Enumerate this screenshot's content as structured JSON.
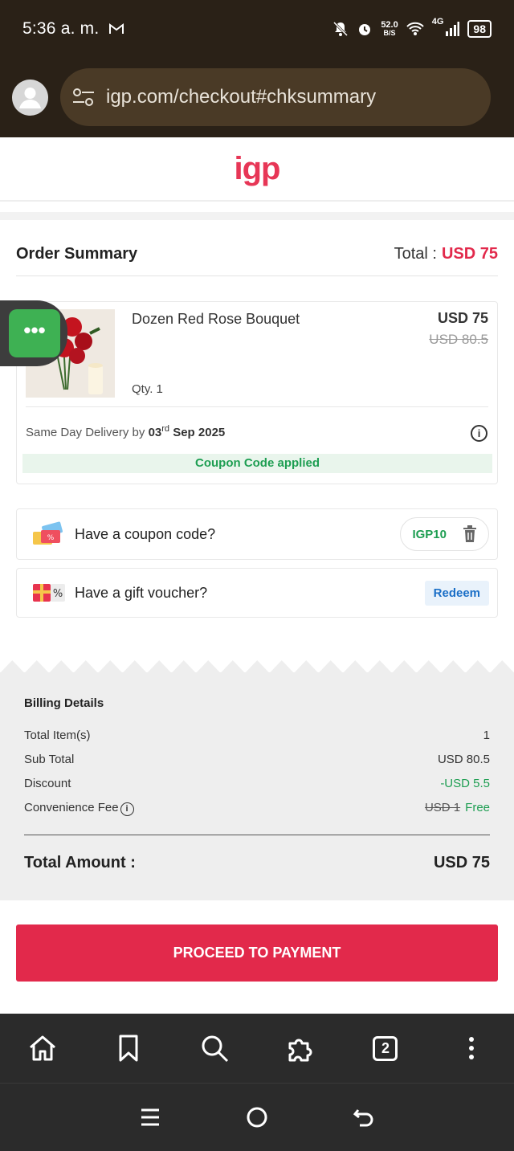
{
  "status_bar": {
    "time": "5:36 a. m.",
    "net_speed": "52.0",
    "net_unit": "B/S",
    "network": "4G",
    "battery": "98"
  },
  "browser": {
    "url": "igp.com/checkout#chksummary"
  },
  "site": {
    "logo": "igp"
  },
  "order_summary": {
    "title": "Order Summary",
    "total_label": "Total :",
    "total_value": "USD 75",
    "product": {
      "name": "Dozen Red Rose Bouquet",
      "price": "USD 75",
      "old_price": "USD 80.5",
      "qty": "Qty. 1",
      "delivery_prefix": "Same Day Delivery by",
      "delivery_day": "03",
      "delivery_suffix": "rd",
      "delivery_month_year": "Sep 2025",
      "coupon_status": "Coupon Code applied"
    }
  },
  "coupon": {
    "label": "Have a coupon code?",
    "code": "IGP10"
  },
  "voucher": {
    "label": "Have a gift voucher?",
    "button": "Redeem"
  },
  "billing": {
    "title": "Billing Details",
    "rows": [
      {
        "label": "Total Item(s)",
        "value": "1"
      },
      {
        "label": "Sub Total",
        "value": "USD 80.5"
      },
      {
        "label": "Discount",
        "value": "-USD 5.5"
      },
      {
        "label": "Convenience Fee",
        "old_value": "USD 1",
        "value": "Free"
      }
    ],
    "total_label": "Total Amount :",
    "total_value": "USD 75"
  },
  "cta": {
    "label": "PROCEED TO PAYMENT"
  },
  "bottom_nav": {
    "tabs_count": "2"
  },
  "colors": {
    "accent": "#e2294b",
    "success": "#1e9e52",
    "link": "#1b6fc7"
  }
}
